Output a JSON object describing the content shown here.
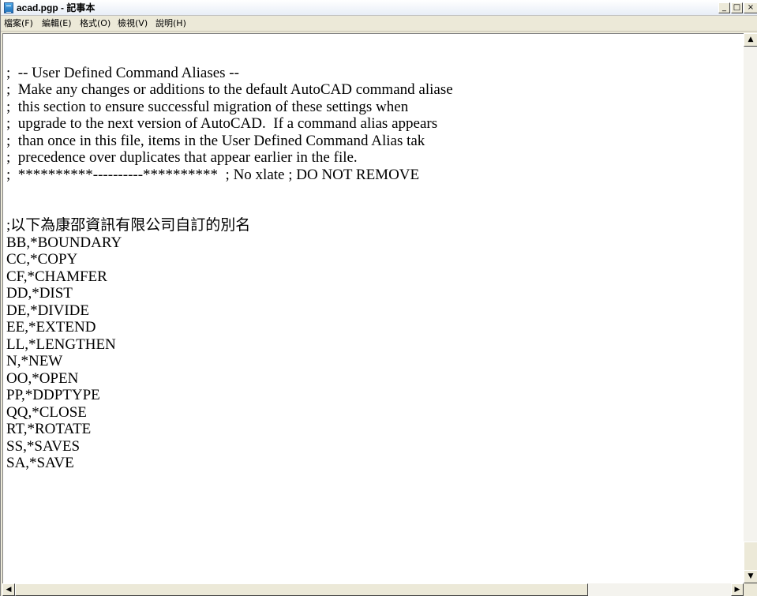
{
  "window": {
    "title": "acad.pgp - 記事本",
    "controls": {
      "minimize": "_",
      "maximize": "□",
      "close": "×"
    }
  },
  "menu": [
    {
      "label": "檔案(F)"
    },
    {
      "label": "編輯(E)"
    },
    {
      "label": "格式(O)"
    },
    {
      "label": "檢視(V)"
    },
    {
      "label": "說明(H)"
    }
  ],
  "editor": {
    "lines": [
      "",
      ";  -- User Defined Command Aliases --",
      ";  Make any changes or additions to the default AutoCAD command aliase",
      ";  this section to ensure successful migration of these settings when",
      ";  upgrade to the next version of AutoCAD.  If a command alias appears",
      ";  than once in this file, items in the User Defined Command Alias tak",
      ";  precedence over duplicates that appear earlier in the file.",
      ";  **********----------**********  ; No xlate ; DO NOT REMOVE",
      "",
      "",
      ";以下為康邵資訊有限公司自訂的別名",
      "BB,*BOUNDARY",
      "CC,*COPY",
      "CF,*CHAMFER",
      "DD,*DIST",
      "DE,*DIVIDE",
      "EE,*EXTEND",
      "LL,*LENGTHEN",
      "N,*NEW",
      "OO,*OPEN",
      "PP,*DDPTYPE",
      "QQ,*CLOSE",
      "RT,*ROTATE",
      "SS,*SAVES",
      "SA,*SAVE"
    ]
  },
  "scrollbars": {
    "vertical": {
      "up_arrow": "▲",
      "down_arrow": "▼"
    },
    "horizontal": {
      "left_arrow": "◀",
      "right_arrow": "▶"
    }
  }
}
